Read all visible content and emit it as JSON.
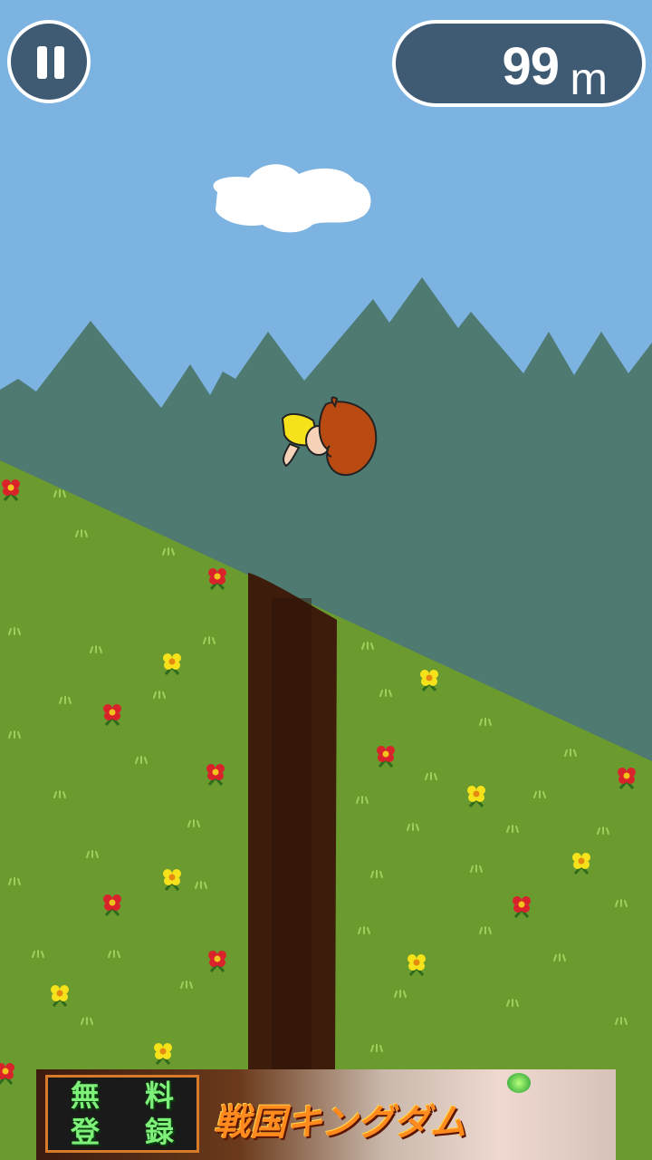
{
  "hud": {
    "distance_value": "99",
    "distance_unit": "m",
    "pause_icon": "pause-icon"
  },
  "scene": {
    "sky_color": "#7cb3e1",
    "mountain_color": "#4f7a72",
    "grass_color": "#6b9a2e",
    "trunk_color": "#3d1c0c",
    "character": "falling-cartoon-kid-icon"
  },
  "ad": {
    "free_chars": [
      "無",
      "料",
      "登",
      "録"
    ],
    "title": "戦国キングダム"
  }
}
